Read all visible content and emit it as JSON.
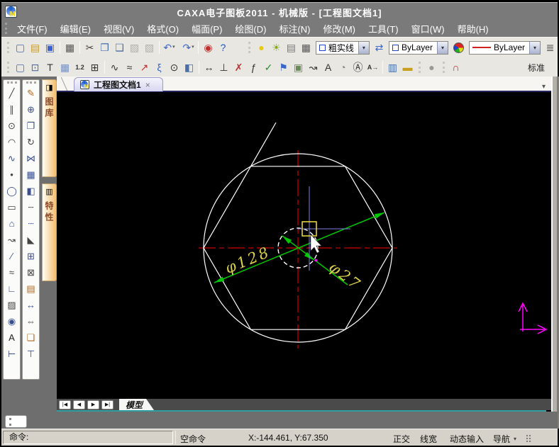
{
  "window": {
    "title": "CAXA电子图板2011 - 机械版 - [工程图文档1]",
    "logo_letter": "M"
  },
  "menu": {
    "items": [
      {
        "name": "menu-file",
        "label": "文件(F)"
      },
      {
        "name": "menu-edit",
        "label": "编辑(E)"
      },
      {
        "name": "menu-view",
        "label": "视图(V)"
      },
      {
        "name": "menu-format",
        "label": "格式(O)"
      },
      {
        "name": "menu-sheet",
        "label": "幅面(P)"
      },
      {
        "name": "menu-draw",
        "label": "绘图(D)"
      },
      {
        "name": "menu-dim",
        "label": "标注(N)"
      },
      {
        "name": "menu-modify",
        "label": "修改(M)"
      },
      {
        "name": "menu-tools",
        "label": "工具(T)"
      },
      {
        "name": "menu-window",
        "label": "窗口(W)"
      },
      {
        "name": "menu-help",
        "label": "帮助(H)"
      }
    ]
  },
  "toolbar_standard": {
    "file_group": [
      {
        "name": "new-file-icon",
        "g": "▢",
        "c": "#4a6ea9"
      },
      {
        "name": "open-file-icon",
        "g": "▤",
        "c": "#c89a2a"
      },
      {
        "name": "save-file-icon",
        "g": "▣",
        "c": "#3a5fd0"
      }
    ],
    "print_group": [
      {
        "name": "print-icon",
        "g": "▦",
        "c": "#555555"
      }
    ],
    "clipboard_group": [
      {
        "name": "cut-icon",
        "g": "✂",
        "c": "#444444"
      },
      {
        "name": "copy-icon",
        "g": "❐",
        "c": "#4a6ea9"
      },
      {
        "name": "copy-basepoint-icon",
        "g": "❑",
        "c": "#4a6ea9"
      },
      {
        "name": "paste-icon",
        "g": "▨",
        "c": "#b0aea8",
        "cls": "dis"
      },
      {
        "name": "paste-special-icon",
        "g": "▧",
        "c": "#b0aea8",
        "cls": "dis"
      }
    ],
    "undo_group": [
      {
        "name": "undo-icon",
        "g": "↶",
        "c": "#3a66c8",
        "cls": "caret"
      },
      {
        "name": "redo-icon",
        "g": "↷",
        "c": "#3a66c8",
        "cls": "caret"
      }
    ],
    "help_group": [
      {
        "name": "e-seal-icon",
        "g": "◉",
        "c": "#c03030"
      },
      {
        "name": "help-icon",
        "g": "?",
        "c": "#2050c0"
      }
    ],
    "layer_tools": [
      {
        "name": "layer-on-icon",
        "g": "●",
        "c": "#e8c818"
      },
      {
        "name": "brightness-icon",
        "g": "☀",
        "c": "#88a822"
      },
      {
        "name": "layer-lock-icon",
        "g": "▤",
        "c": "#777777"
      },
      {
        "name": "plot-layer-icon",
        "g": "▦",
        "c": "#555555"
      }
    ],
    "layer_combo": {
      "value": "粗实线"
    },
    "transfer_icon": [
      {
        "name": "layer-transfer-icon",
        "g": "⇄",
        "c": "#3a66c8"
      }
    ],
    "color_combo": {
      "value": "ByLayer"
    },
    "linetype_combo": {
      "value": "ByLayer"
    },
    "end_icon": [
      {
        "name": "style-manager-icon",
        "g": "≣",
        "c": "#444444"
      }
    ]
  },
  "toolbar_second": {
    "view_group": [
      {
        "name": "select-window-icon",
        "g": "▢",
        "c": "#4a6ea9"
      },
      {
        "name": "zoom-window-icon",
        "g": "⊡",
        "c": "#4a6ea9"
      },
      {
        "name": "text-window-icon",
        "g": "T",
        "c": "#333333"
      },
      {
        "name": "viewport-grid-icon",
        "g": "▦",
        "c": "#7a8fc0"
      },
      {
        "name": "renumber-icon",
        "g": "1.2",
        "c": "#333333",
        "cls": "small-txt"
      },
      {
        "name": "table-icon",
        "g": "⊞",
        "c": "#333333"
      }
    ],
    "curve_group": [
      {
        "name": "wave-curve-icon",
        "g": "∿",
        "c": "#333333"
      },
      {
        "name": "zigzag-line-icon",
        "g": "≈",
        "c": "#333333"
      },
      {
        "name": "pointer-icon",
        "g": "↗",
        "c": "#c03030"
      },
      {
        "name": "spline-node-icon",
        "g": "ξ",
        "c": "#3a66c8"
      },
      {
        "name": "inspect-icon",
        "g": "⊙",
        "c": "#333333"
      },
      {
        "name": "fill-style-icon",
        "g": "◧",
        "c": "#4a6ea9"
      }
    ],
    "dim_group": [
      {
        "name": "linear-dim-icon",
        "g": "↔",
        "c": "#333333"
      },
      {
        "name": "coord-dim-icon",
        "g": "⊥",
        "c": "#333333"
      },
      {
        "name": "break-curve-icon",
        "g": "✗",
        "c": "#c03030"
      },
      {
        "name": "formula-icon",
        "g": "ƒ",
        "c": "#333333"
      },
      {
        "name": "check-icon",
        "g": "✓",
        "c": "#2a8a2a"
      },
      {
        "name": "datum-flag-icon",
        "g": "⚑",
        "c": "#3a66c8"
      },
      {
        "name": "raster-image-icon",
        "g": "▣",
        "c": "#6a8a5a"
      },
      {
        "name": "leader-icon",
        "g": "↝",
        "c": "#333333"
      },
      {
        "name": "text-edit-icon",
        "g": "A",
        "c": "#333333"
      },
      {
        "name": "sector-icon",
        "g": "◔",
        "c": "#888888"
      },
      {
        "name": "frame-text-icon",
        "g": "Ⓐ",
        "c": "#333333"
      },
      {
        "name": "text-arrow-icon",
        "g": "A→",
        "c": "#333333",
        "cls": "small-txt"
      }
    ],
    "display_group": [
      {
        "name": "display-panel-icon",
        "g": "▥",
        "c": "#4a6ea9"
      },
      {
        "name": "ruler-icon",
        "g": "▬",
        "c": "#c8a020"
      }
    ],
    "mouse_group": [
      {
        "name": "mouse-settings-icon",
        "g": "●",
        "c": "#999999"
      }
    ],
    "magnet_group": [
      {
        "name": "snap-magnet-icon",
        "g": "∩",
        "c": "#c03030"
      }
    ],
    "label": "标准"
  },
  "draw_toolbar": {
    "icons": [
      {
        "name": "line-icon",
        "g": "╱",
        "c": "#444444"
      },
      {
        "name": "parallel-line-icon",
        "g": "∥",
        "c": "#3b4f8f"
      },
      {
        "name": "circle-icon",
        "g": "⊙",
        "c": "#444444"
      },
      {
        "name": "arc-icon",
        "g": "◠",
        "c": "#444444"
      },
      {
        "name": "spline-icon",
        "g": "∿",
        "c": "#3b4f8f"
      },
      {
        "name": "point-icon",
        "g": "•",
        "c": "#444444"
      },
      {
        "name": "ellipse-icon",
        "g": "◯",
        "c": "#3b4f8f"
      },
      {
        "name": "rectangle-icon",
        "g": "▭",
        "c": "#444444"
      },
      {
        "name": "polygon-icon",
        "g": "⌂",
        "c": "#3b4f8f"
      },
      {
        "name": "polyline-icon",
        "g": "↝",
        "c": "#444444"
      },
      {
        "name": "bisector-icon",
        "g": "∕",
        "c": "#3b4f8f"
      },
      {
        "name": "offset-icon",
        "g": "≈",
        "c": "#444444"
      },
      {
        "name": "coordinates-icon",
        "g": "∟",
        "c": "#3b4f8f"
      },
      {
        "name": "hatch-icon",
        "g": "▨",
        "c": "#444444"
      },
      {
        "name": "fill-icon",
        "g": "◉",
        "c": "#3b4f8f"
      },
      {
        "name": "text-icon",
        "g": "A",
        "c": "#222222"
      },
      {
        "name": "dimension-icon",
        "g": "⊢",
        "c": "#3b4f8f"
      }
    ]
  },
  "modify_toolbar": {
    "icons": [
      {
        "name": "erase-icon",
        "g": "✎",
        "c": "#b06820"
      },
      {
        "name": "move-icon",
        "g": "⊕",
        "c": "#3b4f8f"
      },
      {
        "name": "copy-entity-icon",
        "g": "❐",
        "c": "#3b4f8f"
      },
      {
        "name": "rotate-icon",
        "g": "↻",
        "c": "#444444"
      },
      {
        "name": "mirror-icon",
        "g": "⋈",
        "c": "#3b4f8f"
      },
      {
        "name": "array-icon",
        "g": "▦",
        "c": "#3b4f8f"
      },
      {
        "name": "stretch-icon",
        "g": "◧",
        "c": "#3b4f8f"
      },
      {
        "name": "trim-icon",
        "g": "┄",
        "c": "#444444"
      },
      {
        "name": "extend-icon",
        "g": "┈",
        "c": "#3b4f8f"
      },
      {
        "name": "chamfer-icon",
        "g": "◣",
        "c": "#444444"
      },
      {
        "name": "scale-icon",
        "g": "⊞",
        "c": "#3b4f8f"
      },
      {
        "name": "explode-icon",
        "g": "⊠",
        "c": "#444444"
      },
      {
        "name": "properties-icon",
        "g": "▤",
        "c": "#b06820"
      },
      {
        "name": "edit-dim-icon",
        "g": "↔",
        "c": "#3b4f8f"
      },
      {
        "name": "swap-dim-icon",
        "g": "⇔",
        "c": "#444444"
      },
      {
        "name": "format-brush-icon",
        "g": "❏",
        "c": "#b06820"
      },
      {
        "name": "tolerance-icon",
        "g": "⊤",
        "c": "#3b4f8f"
      }
    ]
  },
  "side_tabs": [
    {
      "name": "tab-library",
      "icon": "◨",
      "label": "图库"
    },
    {
      "name": "tab-properties",
      "icon": "▥",
      "label": "特性"
    }
  ],
  "doc_tab": {
    "label": "工程图文档1",
    "close": "×"
  },
  "sheet_nav": {
    "buttons": [
      {
        "name": "first-sheet-button",
        "g": "|◀"
      },
      {
        "name": "prev-sheet-button",
        "g": "◀"
      },
      {
        "name": "next-sheet-button",
        "g": "▶"
      },
      {
        "name": "last-sheet-button",
        "g": "▶|"
      }
    ],
    "model_tab": "模型"
  },
  "drawing": {
    "dim_large": {
      "label": "φ128",
      "value": 128
    },
    "dim_small": {
      "label": "φ27",
      "value": 27
    },
    "entities": {
      "large_circle_diameter": 128,
      "small_circle_diameter": 27,
      "hexagon": "regular hexagon inscribed in large circle",
      "centerlines": "red dash-dot cross at center",
      "colors": {
        "geometry": "#ffffff",
        "centerline": "#ff0000",
        "dimension_line": "#00c800",
        "dimension_text": "#ddd34a",
        "crosshair": "#8080e0",
        "pickbox": "#f0e040",
        "ucs_axes": "#ff00ff"
      }
    }
  },
  "statusbar": {
    "command_label": "命令:",
    "mode": "空命令",
    "coords": "X:-144.461, Y:67.350",
    "ortho": "正交",
    "lineweight": "线宽",
    "dynamic_input": "动态输入",
    "navigation": "导航"
  }
}
